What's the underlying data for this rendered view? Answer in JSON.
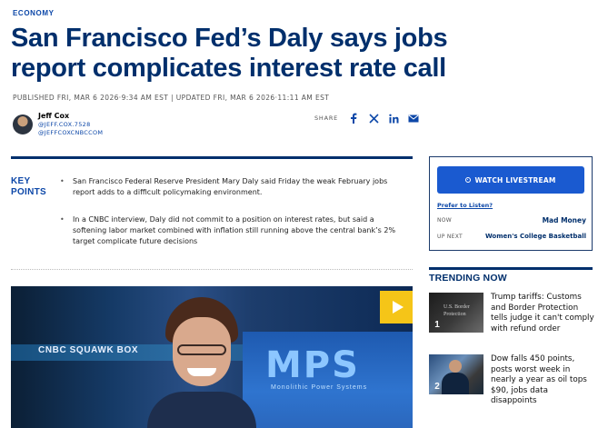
{
  "article": {
    "section": "ECONOMY",
    "headline": "San Francisco Fed’s Daly says jobs report complicates interest rate call",
    "timestamp": "PUBLISHED FRI, MAR 6 2026·9:34 AM EST | UPDATED FRI, MAR 6 2026·11:11 AM EST",
    "author": {
      "name": "Jeff Cox",
      "handle1": "@JEFF.COX.7528",
      "handle2": "@JEFFCOXCNBCCOM"
    },
    "share": {
      "label": "SHARE",
      "icons": [
        "facebook-icon",
        "x-icon",
        "linkedin-icon",
        "email-icon"
      ]
    },
    "key_points": {
      "title_line1": "KEY",
      "title_line2": "POINTS",
      "items": [
        "San Francisco Federal Reserve President Mary Daly said Friday the weak February jobs report adds to a difficult policymaking environment.",
        "In a CNBC interview, Daly did not commit to a position on interest rates, but said a softening labor market combined with inflation still running above the central bank’s 2% target complicate future decisions"
      ]
    },
    "video": {
      "banner_text": "CNBC SQUAWK BOX",
      "screen_logo": "MPS",
      "screen_sub": "Monolithic Power Systems"
    }
  },
  "sidebar": {
    "livestream_label": "WATCH LIVESTREAM",
    "listen_label": "Prefer to Listen?",
    "now_label": "NOW",
    "now_show": "Mad Money",
    "next_label": "UP NEXT",
    "next_show": "Women's College Basketball",
    "trending_title": "TRENDING NOW",
    "trending": [
      {
        "rank": "1",
        "text": "Trump tariffs: Customs and Border Protection tells judge it can't comply with refund order"
      },
      {
        "rank": "2",
        "text": "Dow falls 450 points, posts worst week in nearly a year as oil tops $90, jobs data disappoints"
      }
    ]
  },
  "colors": {
    "brand_navy": "#002f6c",
    "link_blue": "#0c47a8",
    "button_blue": "#1a5ad0",
    "play_yellow": "#f5c518"
  }
}
